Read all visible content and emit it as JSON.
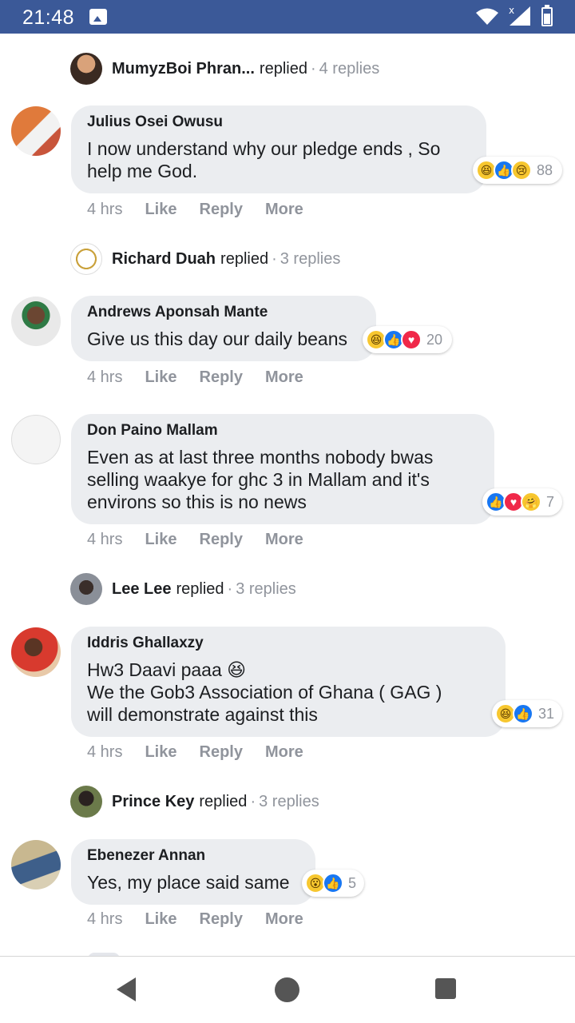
{
  "status": {
    "time": "21:48"
  },
  "replies": [
    {
      "name": "MumyzBoi Phran...",
      "verb": "replied",
      "count": "4 replies"
    },
    {
      "name": "Richard Duah",
      "verb": "replied",
      "count": "3 replies"
    },
    {
      "name": "Lee Lee",
      "verb": "replied",
      "count": "3 replies"
    },
    {
      "name": "Prince Key",
      "verb": "replied",
      "count": "3 replies"
    }
  ],
  "comments": [
    {
      "name": "Julius Osei Owusu",
      "text": "I now understand why our pledge ends , So\nhelp me God.",
      "reactions": [
        "haha",
        "like",
        "sad"
      ],
      "reaction_count": "88",
      "time": "4 hrs"
    },
    {
      "name": "Andrews Aponsah Mante",
      "text": "Give us this day our daily beans",
      "reactions": [
        "haha",
        "like",
        "love"
      ],
      "reaction_count": "20",
      "time": "4 hrs"
    },
    {
      "name": "Don Paino Mallam",
      "text": "Even as at last three months nobody bwas\nselling waakye for ghc 3 in Mallam and it's\nenvirons so this is no news",
      "reactions": [
        "like",
        "love",
        "care"
      ],
      "reaction_count": "7",
      "time": "4 hrs"
    },
    {
      "name": "Iddris Ghallaxzy",
      "text": "Hw3 Daavi paaa 😆\nWe the Gob3 Association of Ghana ( GAG )\nwill demonstrate against this",
      "reactions": [
        "haha",
        "like"
      ],
      "reaction_count": "31",
      "time": "4 hrs"
    },
    {
      "name": "Ebenezer Annan",
      "text": "Yes, my place said same",
      "reactions": [
        "wow",
        "like"
      ],
      "reaction_count": "5",
      "time": "4 hrs"
    }
  ],
  "actions": {
    "like": "Like",
    "reply": "Reply",
    "more": "More"
  },
  "reply_separator": "·",
  "colors": {
    "status_bar": "#3b5998",
    "bubble": "#ebedf0",
    "meta_text": "#90949c",
    "like_blue": "#1877f2"
  }
}
